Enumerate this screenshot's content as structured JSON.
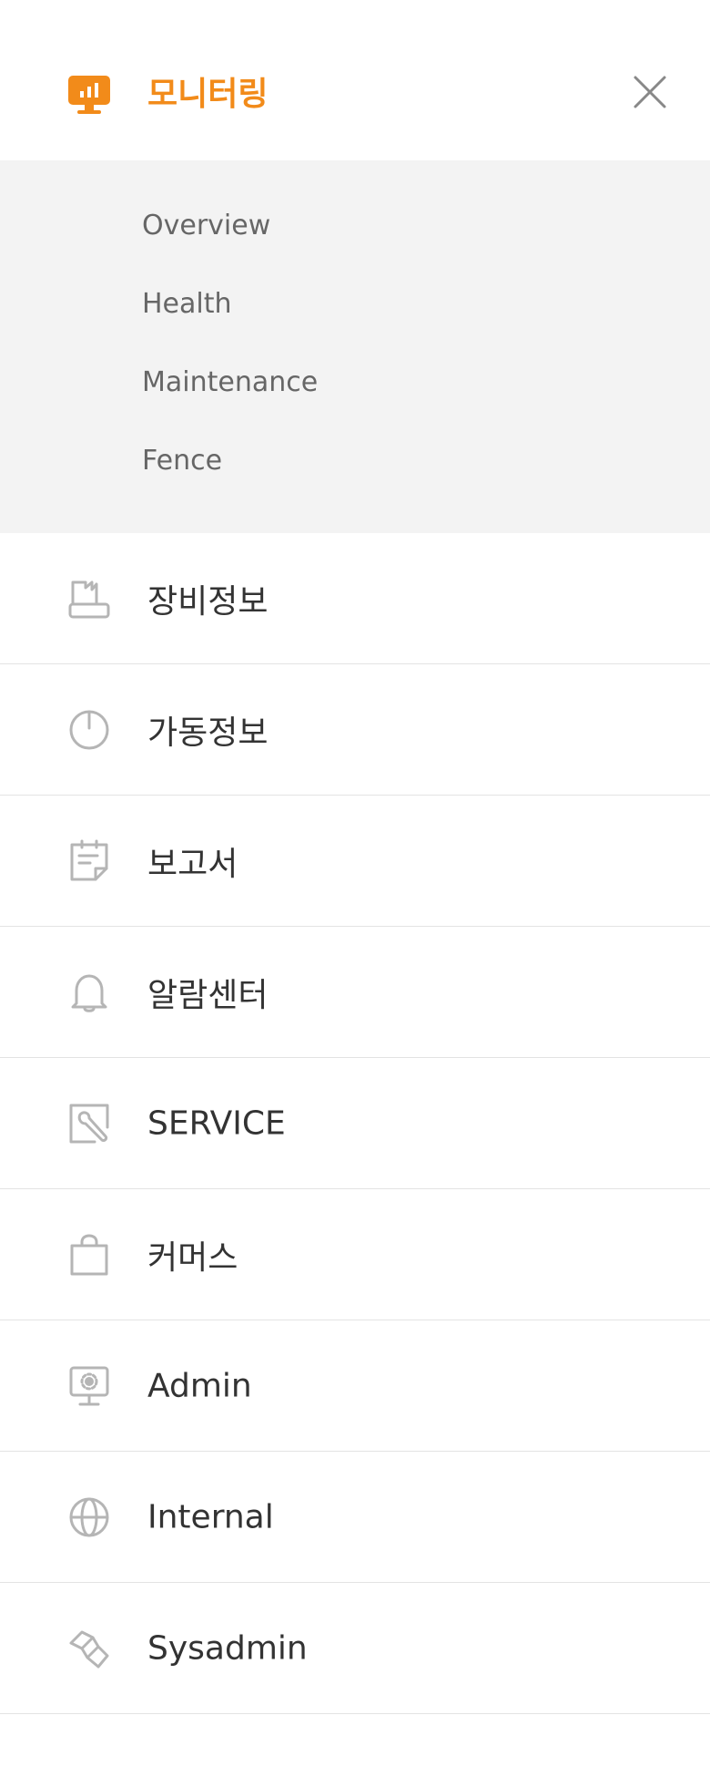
{
  "header": {
    "title": "모니터링",
    "icon": "monitoring-chart-icon",
    "close_icon": "close-icon",
    "accent_color": "#f28b1a"
  },
  "submenu": {
    "items": [
      {
        "label": "Overview"
      },
      {
        "label": "Health"
      },
      {
        "label": "Maintenance"
      },
      {
        "label": "Fence"
      }
    ]
  },
  "menu": {
    "items": [
      {
        "label": "장비정보",
        "icon": "equipment-icon"
      },
      {
        "label": "가동정보",
        "icon": "power-icon"
      },
      {
        "label": "보고서",
        "icon": "report-icon"
      },
      {
        "label": "알람센터",
        "icon": "bell-icon"
      },
      {
        "label": "SERVICE",
        "icon": "service-tool-icon"
      },
      {
        "label": "커머스",
        "icon": "shopping-bag-icon"
      },
      {
        "label": "Admin",
        "icon": "admin-monitor-icon"
      },
      {
        "label": "Internal",
        "icon": "globe-icon"
      },
      {
        "label": "Sysadmin",
        "icon": "sysadmin-icon"
      }
    ]
  }
}
